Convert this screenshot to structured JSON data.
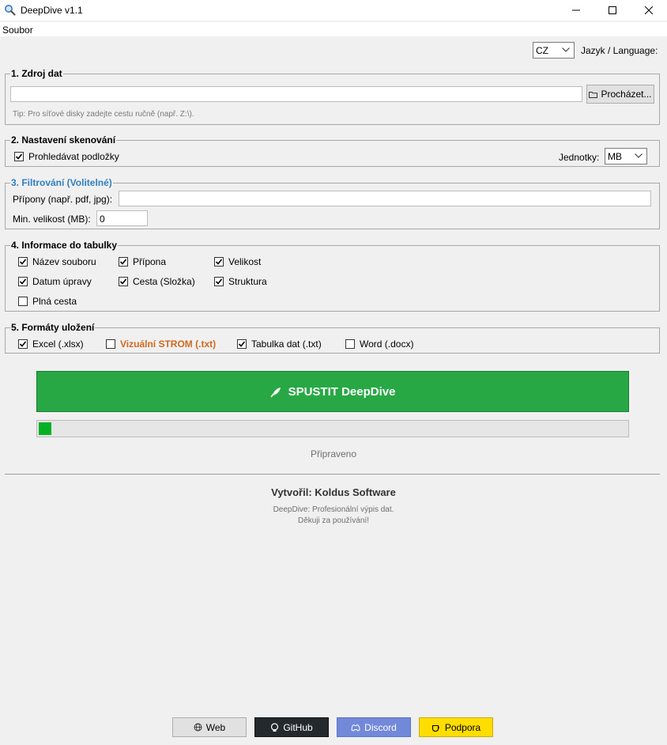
{
  "window": {
    "title": "DeepDive v1.1"
  },
  "menu": {
    "file": "Soubor"
  },
  "language": {
    "selected": "CZ",
    "label": "Jazyk / Language:"
  },
  "source": {
    "title": "1. Zdroj dat",
    "path_value": "",
    "browse_label": "Procházet...",
    "tip": "Tip: Pro síťové disky zadejte cestu ručně (např. Z:\\)."
  },
  "scan": {
    "title": "2. Nastavení skenování",
    "subfolders_label": "Prohledávat podložky",
    "subfolders_checked": true,
    "units_label": "Jednotky:",
    "units_selected": "MB"
  },
  "filter": {
    "title": "3. Filtrování (Volitelné)",
    "extensions_label": "Přípony (např. pdf, jpg):",
    "extensions_value": "",
    "min_size_label": "Min. velikost (MB):",
    "min_size_value": "0"
  },
  "table_info": {
    "title": "4. Informace do tabulky",
    "options": [
      {
        "label": "Název souboru",
        "checked": true
      },
      {
        "label": "Přípona",
        "checked": true
      },
      {
        "label": "Velikost",
        "checked": true
      },
      {
        "label": "Datum úpravy",
        "checked": true
      },
      {
        "label": "Cesta (Složka)",
        "checked": true
      },
      {
        "label": "Struktura",
        "checked": true
      },
      {
        "label": "Plná cesta",
        "checked": false
      }
    ]
  },
  "formats": {
    "title": "5. Formáty uložení",
    "options": [
      {
        "label": "Excel (.xlsx)",
        "checked": true
      },
      {
        "label": "Vizuální STROM (.txt)",
        "checked": false
      },
      {
        "label": "Tabulka dat (.txt)",
        "checked": true
      },
      {
        "label": "Word (.docx)",
        "checked": false
      }
    ]
  },
  "run": {
    "label": "SPUSTIT DeepDive",
    "icon": "rocket-icon",
    "color": "#27a845"
  },
  "progress": {
    "fraction": 0.02,
    "color": "#06b025"
  },
  "status": "Připraveno",
  "footer": {
    "author": "Vytvořil: Koldus Software",
    "line1": "DeepDive: Profesionální výpis dat.",
    "line2": "Děkuji za používání!",
    "links": [
      {
        "label": "Web",
        "icon": "globe-icon",
        "bg": "#e1e1e1",
        "fg": "#000000"
      },
      {
        "label": "GitHub",
        "icon": "github-icon",
        "bg": "#24292e",
        "fg": "#ffffff"
      },
      {
        "label": "Discord",
        "icon": "discord-icon",
        "bg": "#7289da",
        "fg": "#ffffff"
      },
      {
        "label": "Podpora",
        "icon": "coffee-icon",
        "bg": "#ffdd00",
        "fg": "#000000"
      }
    ]
  }
}
